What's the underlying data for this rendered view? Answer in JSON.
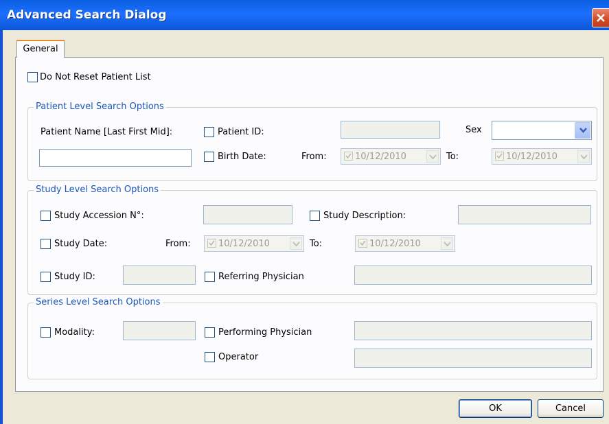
{
  "window": {
    "title": "Advanced Search Dialog"
  },
  "tabs": [
    {
      "label": "General"
    }
  ],
  "reset_option": {
    "label": "Do Not Reset Patient List"
  },
  "patient_group": {
    "legend": "Patient Level Search Options",
    "patient_name_label": "Patient Name [Last First Mid]:",
    "patient_name_value": "",
    "patient_id_label": "Patient ID:",
    "sex_label": "Sex",
    "sex_value": "",
    "birth_date_label": "Birth Date:",
    "from_label": "From:",
    "from_date": "10/12/2010",
    "to_label": "To:",
    "to_date": "10/12/2010"
  },
  "study_group": {
    "legend": "Study Level Search Options",
    "accession_label": "Study Accession N°:",
    "description_label": "Study Description:",
    "study_date_label": "Study Date:",
    "from_label": "From:",
    "from_date": "10/12/2010",
    "to_label": "To:",
    "to_date": "10/12/2010",
    "study_id_label": "Study ID:",
    "referring_label": "Referring Physician"
  },
  "series_group": {
    "legend": "Series Level Search Options",
    "modality_label": "Modality:",
    "performing_label": "Performing Physician",
    "operator_label": "Operator"
  },
  "buttons": {
    "ok": "OK",
    "cancel": "Cancel"
  },
  "colors": {
    "titlebar": "#0a5fe0",
    "legend_text": "#1c56b8",
    "dialog_bg": "#ece9d8",
    "close_button": "#d24a24"
  }
}
